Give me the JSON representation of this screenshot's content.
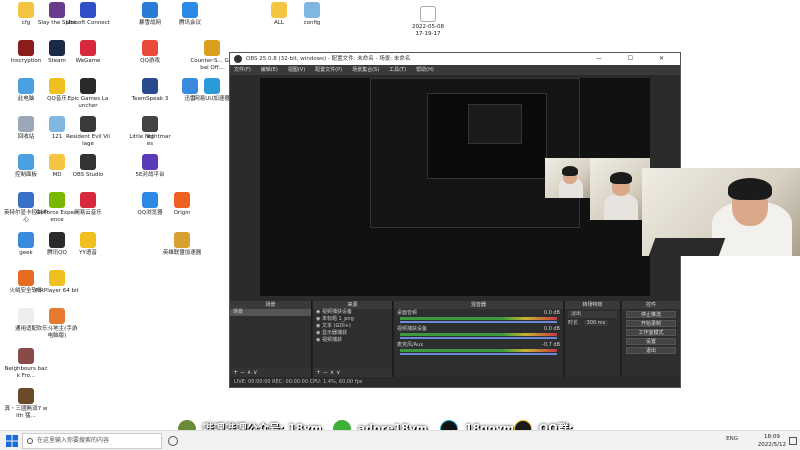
{
  "desktop": {
    "icons": [
      {
        "label": "cfg",
        "color": "#f5c542"
      },
      {
        "label": "Slay the Spire",
        "color": "#6a3a8c"
      },
      {
        "label": "Ubisoft Connect",
        "color": "#3050c8"
      },
      {
        "label": "暴雪战网",
        "color": "#2a7bd6"
      },
      {
        "label": "腾讯会议",
        "color": "#2a8ae6"
      },
      {
        "label": "ALL",
        "color": "#f5c542"
      },
      {
        "label": "config",
        "color": "#7fb7e0"
      },
      {
        "label": "Inscryption",
        "color": "#8c1b1b"
      },
      {
        "label": "Steam",
        "color": "#1b2a44"
      },
      {
        "label": "WeGame",
        "color": "#d8283c"
      },
      {
        "label": "QQ游戏",
        "color": "#e84a3c"
      },
      {
        "label": "Counter-S... Global Off...",
        "color": "#d9a020"
      },
      {
        "label": "此电脑",
        "color": "#4aa0e0"
      },
      {
        "label": "QQ音乐",
        "color": "#f0c020"
      },
      {
        "label": "Epic Games Launcher",
        "color": "#2a2a2a"
      },
      {
        "label": "TeamSpeak 3",
        "color": "#2a4c8c"
      },
      {
        "label": "迅雷",
        "color": "#3a8ae0"
      },
      {
        "label": "网易UU加速器",
        "color": "#2a9ad8"
      },
      {
        "label": "回收站",
        "color": "#9aa8b8"
      },
      {
        "label": "121",
        "color": "#7fb7e0"
      },
      {
        "label": "Resident Evil Village",
        "color": "#3a3a3a"
      },
      {
        "label": "lol",
        "color": "#7fb7e0"
      },
      {
        "label": "Little Nightmares",
        "color": "#444"
      },
      {
        "label": "控制面板",
        "color": "#4aa0e0"
      },
      {
        "label": "MD",
        "color": "#f5c542"
      },
      {
        "label": "OBS Studio",
        "color": "#333"
      },
      {
        "label": "5E对战平台",
        "color": "#5a3ab8"
      },
      {
        "label": "英特尔显卡控制中心",
        "color": "#3a70c8"
      },
      {
        "label": "GeForce Experience",
        "color": "#76b900"
      },
      {
        "label": "网易云音乐",
        "color": "#d8283c"
      },
      {
        "label": "QQ浏览器",
        "color": "#2a8ae6"
      },
      {
        "label": "Origin",
        "color": "#f06020"
      },
      {
        "label": "geek",
        "color": "#3a8ae0"
      },
      {
        "label": "腾讯QQ",
        "color": "#2a2a2a"
      },
      {
        "label": "YY语音",
        "color": "#f0c020"
      },
      {
        "label": "英雄联盟加速器",
        "color": "#d8a030"
      },
      {
        "label": "火绒安全软件",
        "color": "#e86a20"
      },
      {
        "label": "PotPlayer 64 bit",
        "color": "#f0c020"
      },
      {
        "label": "通用适配",
        "color": "#eee"
      },
      {
        "label": "欢乐斗地主(手游电脑版)",
        "color": "#e87a30"
      },
      {
        "label": "Neighbours back Fro...",
        "color": "#8a4a4a"
      },
      {
        "label": "真・三國無双7 with 猛...",
        "color": "#6a4a2a"
      }
    ],
    "timestamp_file": {
      "line1": "2022-05-08",
      "line2": "17-19-17"
    }
  },
  "obs": {
    "title": "OBS 25.0.8 (32-bit, windows) - 配置文件: 未命名 - 场景: 未命名",
    "window_controls": "— ☐ ✕",
    "menu": [
      "文件(F)",
      "编辑(E)",
      "视图(V)",
      "配置文件(P)",
      "场景集合(S)",
      "工具(T)",
      "帮助(H)"
    ],
    "panels": {
      "scenes": {
        "header": "场景",
        "items": [
          "场景"
        ]
      },
      "sources": {
        "header": "来源",
        "items": [
          "视频捕获设备",
          "未标题 1_png",
          "文本 (GDI+)",
          "显示器捕获",
          "视频捕获"
        ]
      },
      "mixer": {
        "header": "混音器",
        "channels": [
          {
            "name": "桌面音频",
            "db": "0.0 dB"
          },
          {
            "name": "视频捕获设备",
            "db": "0.0 dB"
          },
          {
            "name": "麦克风/Aux",
            "db": "-0.7 dB"
          }
        ]
      },
      "transitions": {
        "header": "转场特效",
        "type": "淡出",
        "duration_label": "时长",
        "duration": "300 ms"
      },
      "controls": {
        "header": "控件",
        "buttons": [
          "停止推流",
          "开始录制",
          "工作室模式",
          "设置",
          "退出"
        ]
      }
    },
    "footer_symbols": "+ − ∧ ∨",
    "status": "LIVE: 00:00:00   REC: 00:00:00   CPU: 1.4%, 60.00 fps"
  },
  "banner": {
    "bilibili": "哔哩哔哩公众号: 18ym",
    "wechat": "adore18ym",
    "tiktok": "18goym",
    "qq": "QQ群: 140772309"
  },
  "taskbar": {
    "search_placeholder": "在这里输入你要搜索的内容",
    "ime": "ENG",
    "time": "18:09",
    "date": "2022/5/12"
  },
  "colors": {
    "obs_bg": "#2b2b2b",
    "meter_green": "#3c9a3c",
    "meter_yellow": "#c8b232",
    "meter_red": "#c43c3c"
  }
}
